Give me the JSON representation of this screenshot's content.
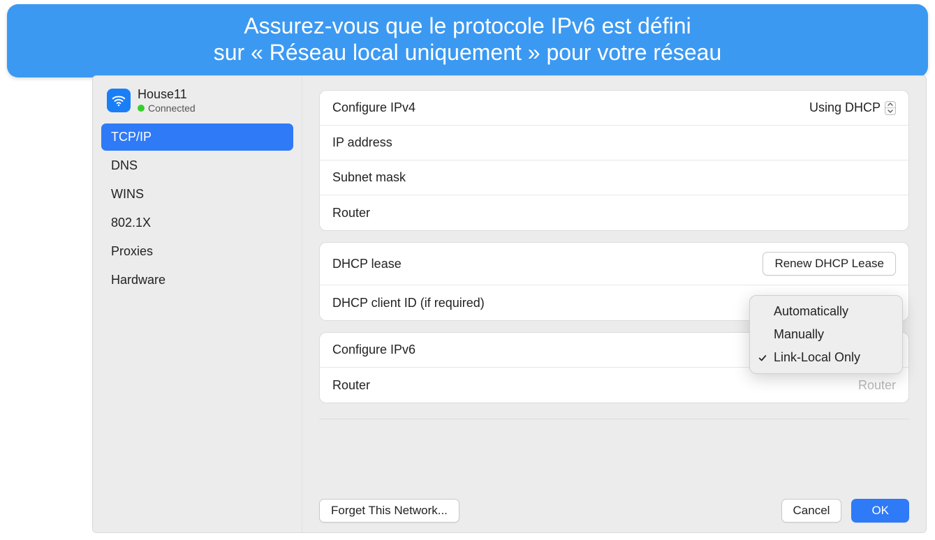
{
  "banner": {
    "line1": "Assurez-vous que le protocole IPv6 est défini",
    "line2": "sur « Réseau local uniquement » pour votre réseau"
  },
  "sidebar": {
    "network": {
      "name": "House11",
      "status": "Connected",
      "icon": "wifi-icon"
    },
    "tabs": [
      {
        "label": "TCP/IP",
        "active": true
      },
      {
        "label": "DNS",
        "active": false
      },
      {
        "label": "WINS",
        "active": false
      },
      {
        "label": "802.1X",
        "active": false
      },
      {
        "label": "Proxies",
        "active": false
      },
      {
        "label": "Hardware",
        "active": false
      }
    ]
  },
  "content": {
    "group1": {
      "configureIPv4Label": "Configure IPv4",
      "configureIPv4Value": "Using DHCP",
      "ipAddressLabel": "IP address",
      "subnetMaskLabel": "Subnet mask",
      "routerLabel": "Router"
    },
    "group2": {
      "dhcpLeaseLabel": "DHCP lease",
      "renewButton": "Renew DHCP Lease",
      "dhcpClientIdLabel": "DHCP client ID (if required)"
    },
    "group3": {
      "configureIPv6Label": "Configure IPv6",
      "routerLabel": "Router",
      "routerPlaceholder": "Router"
    },
    "ipv6Dropdown": {
      "options": [
        {
          "label": "Automatically",
          "checked": false
        },
        {
          "label": "Manually",
          "checked": false
        },
        {
          "label": "Link-Local Only",
          "checked": true
        }
      ]
    }
  },
  "footer": {
    "forget": "Forget This Network...",
    "cancel": "Cancel",
    "ok": "OK"
  }
}
